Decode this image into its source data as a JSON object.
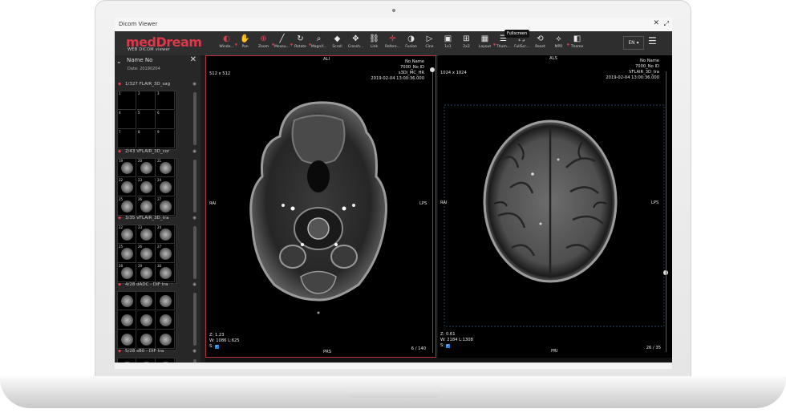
{
  "window": {
    "title": "Dicom Viewer",
    "close": "✕",
    "restore": "⤢"
  },
  "brand": {
    "name": "medDream",
    "subtitle": "WEB DICOM viewer"
  },
  "toolbar": {
    "tools": [
      {
        "id": "windowing",
        "label": "Windo...",
        "icon": "◐",
        "red": true,
        "dropdown": true
      },
      {
        "id": "pan",
        "label": "Pan",
        "icon": "✋",
        "red": true,
        "dropdown": false
      },
      {
        "id": "zoom",
        "label": "Zoom",
        "icon": "⊕",
        "red": true,
        "dropdown": true
      },
      {
        "id": "measure",
        "label": "Measu...",
        "icon": "╱",
        "red": false,
        "dropdown": true
      },
      {
        "id": "rotate",
        "label": "Rotate",
        "icon": "↻",
        "red": false,
        "dropdown": true
      },
      {
        "id": "magnify",
        "label": "Magnif...",
        "icon": "⌕",
        "red": false,
        "dropdown": false
      },
      {
        "id": "scroll",
        "label": "Scroll",
        "icon": "◆",
        "red": false,
        "dropdown": false
      },
      {
        "id": "crosshair",
        "label": "Crossh...",
        "icon": "✥",
        "red": false,
        "dropdown": false
      },
      {
        "id": "link",
        "label": "Link",
        "icon": "⛓",
        "red": false,
        "dropdown": false
      },
      {
        "id": "reference",
        "label": "Refere...",
        "icon": "✛",
        "red": true,
        "dropdown": false
      },
      {
        "id": "fusion",
        "label": "Fusion",
        "icon": "◑",
        "red": false,
        "dropdown": false
      },
      {
        "id": "cine",
        "label": "Cine",
        "icon": "▷",
        "red": false,
        "dropdown": false
      },
      {
        "id": "oneone",
        "label": "1x1",
        "icon": "▣",
        "red": false,
        "dropdown": false
      },
      {
        "id": "twotwo",
        "label": "2x2",
        "icon": "⊞",
        "red": false,
        "dropdown": false
      },
      {
        "id": "layout",
        "label": "Layout",
        "icon": "▦",
        "red": false,
        "dropdown": true
      },
      {
        "id": "thumbnails",
        "label": "Thum...",
        "icon": "☰",
        "red": false,
        "dropdown": false
      },
      {
        "id": "fullscreen",
        "label": "FullScr...",
        "icon": "⛶",
        "red": false,
        "dropdown": false
      },
      {
        "id": "reset",
        "label": "Reset",
        "icon": "⟲",
        "red": false,
        "dropdown": false
      },
      {
        "id": "mpr",
        "label": "MPR",
        "icon": "⟡",
        "red": false,
        "dropdown": true
      },
      {
        "id": "theme",
        "label": "Theme",
        "icon": "◧",
        "red": false,
        "dropdown": false
      }
    ],
    "tooltip": "Fullscreen",
    "language": "EN ▾",
    "settings_icon": "sliders-icon"
  },
  "patient": {
    "name": "Name No",
    "date": "Date:  20190204"
  },
  "series": [
    {
      "label": "1/327   FLAIR_3D_sag",
      "numbers": [
        "1",
        "2",
        "3",
        "4",
        "5",
        "6",
        "7",
        "8",
        "9"
      ]
    },
    {
      "label": "2/43   VFLAIR_3D_cor",
      "numbers": [
        "19",
        "20",
        "21",
        "22",
        "23",
        "24",
        "25",
        "26",
        "27"
      ]
    },
    {
      "label": "3/35   VFLAIR_3D_tra",
      "numbers": [
        "22",
        "23",
        "24",
        "25",
        "26",
        "27",
        "28",
        "29",
        "30"
      ]
    },
    {
      "label": "4/28   dADC - DIF tra",
      "numbers": []
    },
    {
      "label": "5/28   sB0 - DIF tra",
      "numbers": []
    }
  ],
  "viewport1": {
    "top": "ALI",
    "bottom": "PRS",
    "left": "RAI",
    "right": "LPS",
    "size": "512 x 512",
    "info": [
      "No Name",
      "7000_No ID",
      "s3Di_MC_HR",
      "2019-02-04 13:00:36.000"
    ],
    "zoom": "Z: 1.23",
    "wl": "W: 1086 L:625",
    "sync": "S:",
    "frame": "6 / 140"
  },
  "viewport2": {
    "top": "ALS",
    "bottom": "PRI",
    "left": "RAI",
    "right": "LPS",
    "size": "1024 x 1024",
    "info": [
      "No Name",
      "7000_No ID",
      "VFLAIR_3D_tra",
      "2019-02-04 13:00:36.000"
    ],
    "zoom": "Z: 0.61",
    "wl": "W: 2184 L:1308",
    "sync": "S:",
    "frame": "26 / 35"
  }
}
